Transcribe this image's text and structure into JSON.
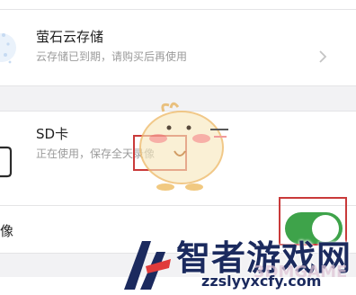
{
  "cloud_storage": {
    "title": "萤石云存储",
    "subtitle": "云存储已到期，请购买后再使用"
  },
  "sd_card": {
    "title": "SD卡",
    "subtitle": "正在使用，保存全天录像"
  },
  "recording": {
    "label": "像",
    "toggle_on": true
  },
  "watermark": {
    "brand": "智者游戏网",
    "url": "zzslyyxcfy.com",
    "overlay": "3DMGAME"
  },
  "colors": {
    "toggle_on": "#3ea34a",
    "highlight_box": "#c93a3a",
    "watermark": "#1b2a5e"
  }
}
